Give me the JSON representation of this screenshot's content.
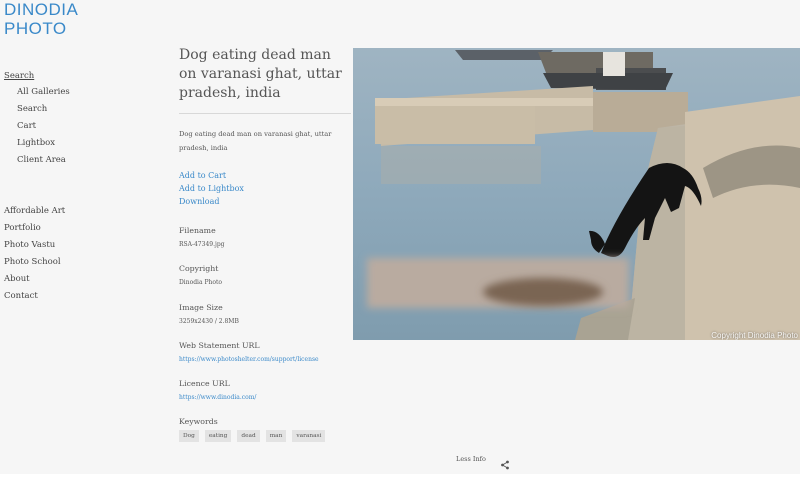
{
  "brand": {
    "line1": "DINODIA",
    "line2": "PHOTO",
    "color": "#3a89c9"
  },
  "nav": {
    "search_head": "Search",
    "sub_items": [
      "All Galleries",
      "Search",
      "Cart",
      "Lightbox",
      "Client Area"
    ],
    "main_items": [
      "Affordable Art",
      "Portfolio",
      "Photo Vastu",
      "Photo School",
      "About",
      "Contact"
    ]
  },
  "image": {
    "title": "Dog eating dead man on varanasi ghat, uttar pradesh, india",
    "description": "Dog eating dead man on varanasi ghat, uttar pradesh, india",
    "copyright_overlay": "Copyright Dinodia Photo"
  },
  "actions": {
    "add_to_cart": "Add to Cart",
    "add_to_lightbox": "Add to Lightbox",
    "download": "Download"
  },
  "meta": {
    "filename_label": "Filename",
    "filename": "RSA-47349.jpg",
    "copyright_label": "Copyright",
    "copyright": "Dinodia Photo",
    "size_label": "Image Size",
    "size": "3259x2430 / 2.8MB",
    "web_statement_label": "Web Statement URL",
    "web_statement": "https://www.photoshelter.com/support/license",
    "licence_label": "Licence URL",
    "licence": "https://www.dinodia.com/",
    "keywords_label": "Keywords",
    "keywords": [
      "Dog",
      "eating",
      "dead",
      "man",
      "varanasi"
    ]
  },
  "footer": {
    "less_info": "Less Info"
  },
  "icons": {
    "share": "share-icon"
  }
}
